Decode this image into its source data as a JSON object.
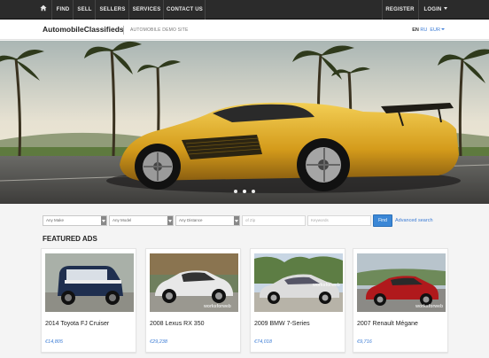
{
  "nav": {
    "home_icon": "home-icon",
    "items": [
      "FIND",
      "SELL",
      "SELLERS",
      "SERVICES",
      "CONTACT US"
    ],
    "register": "REGISTER",
    "login": "LOGIN"
  },
  "header": {
    "logo": "AutomobileClassifieds",
    "tagline": "AUTOMOBILE DEMO SITE",
    "lang_en": "EN",
    "lang_ru": "RU",
    "currency": "EUR"
  },
  "search": {
    "make": "Any Make",
    "model": "Any Model",
    "distance": "Any Distance",
    "zip_placeholder": "of Zip",
    "keywords_placeholder": "Keywords",
    "find": "Find",
    "advanced": "Advanced search"
  },
  "featured": {
    "title": "FEATURED ADS",
    "cards": [
      {
        "title": "2014 Toyota FJ Cruiser",
        "price": "€14,805",
        "color": "#1f2f4f"
      },
      {
        "title": "2008 Lexus RX 350",
        "price": "€29,238",
        "color": "#e8e8e8"
      },
      {
        "title": "2009 BMW 7-Series",
        "price": "€74,018",
        "color": "#dcdcdc"
      },
      {
        "title": "2007 Renault Mégane",
        "price": "€9,716",
        "color": "#b0191c"
      }
    ],
    "watermark": "worksforweb"
  },
  "colors": {
    "nav_bg": "#2b2b2b",
    "accent": "#3a7bd5",
    "hero_car": "#d9a521"
  }
}
